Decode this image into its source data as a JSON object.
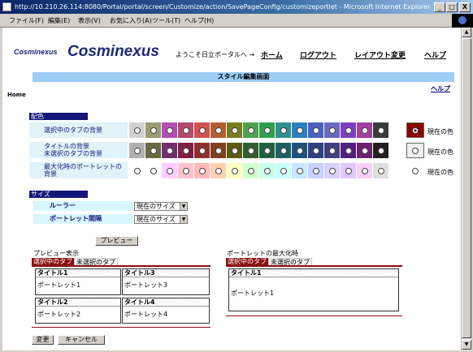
{
  "window": {
    "title": "http://10.210.26.114:8080/Portal/portal/screen/Customize/action/SavePageConfig/customizeportlet - Microsoft Internet Explorer",
    "min": "_",
    "max": "□",
    "close": "X"
  },
  "menu": [
    "ファイル(F)",
    "編集(E)",
    "表示(V)",
    "お気に入り(A)",
    "ツール(T)",
    "ヘルプ(H)"
  ],
  "header": {
    "logo_small": "Cosminexus",
    "logo_large": "Cosminexus",
    "welcome": "ようこそ日立ポータルへ →",
    "links": [
      "ホーム",
      "ログアウト",
      "レイアウト変更",
      "ヘルプ"
    ]
  },
  "page": {
    "title": "スタイル編集画面",
    "help": "ヘルプ",
    "home": "Home"
  },
  "colors_section": {
    "heading": "配色",
    "rows": [
      {
        "label": "選択中のタブの背景",
        "swatches": [
          "#d2d2d2",
          "#9a9a6e",
          "#b050b0",
          "#b24a6c",
          "#d05050",
          "#b06030",
          "#7a7a20",
          "#50a050",
          "#30a050",
          "#309090",
          "#2a80c0",
          "#4a60c0",
          "#6a6ac0",
          "#7a40c0",
          "#a040a0",
          "#3a3a3a"
        ],
        "current_color": "#8b0000",
        "current_selected": true,
        "current_label": "現在の色"
      },
      {
        "label": "タイトルの背景\n未選択のタブの背景",
        "swatches": [
          "#b0b0b0",
          "#6a6a40",
          "#703070",
          "#802040",
          "#903030",
          "#804020",
          "#5a5a10",
          "#306030",
          "#206040",
          "#206060",
          "#205080",
          "#304080",
          "#404080",
          "#502080",
          "#702070",
          "#202020"
        ],
        "current_color": "#f0f0f0",
        "current_selected": false,
        "current_label": "現在の色"
      },
      {
        "label": "最大化時のポートレットの背景",
        "swatches": [
          "#ffffff",
          "#ffffff",
          "#ffccff",
          "#ffc0d0",
          "#ffb8b8",
          "#ffd0b0",
          "#ffffc0",
          "#d0ffd0",
          "#c8ffe8",
          "#c8ffff",
          "#c8e8ff",
          "#c8d0ff",
          "#d8d0ff",
          "#e0c8ff",
          "#f8d0f8",
          "#e0e0e0"
        ],
        "current_color": "#ffffff",
        "current_selected": false,
        "current_label": "現在の色"
      }
    ]
  },
  "size_section": {
    "heading": "サイズ",
    "rows": [
      {
        "label": "ルーラー",
        "value": "現在のサイズ"
      },
      {
        "label": "ポートレット間隔",
        "value": "現在のサイズ"
      }
    ],
    "preview_button": "プレビュー"
  },
  "preview": {
    "heading": "プレビュー表示",
    "tab_selected": "選択中のタブ",
    "tab_unselected": "未選択のタブ",
    "portlets": [
      {
        "title": "タイトル1",
        "body": "ポートレット1"
      },
      {
        "title": "タイトル3",
        "body": "ポートレット3"
      },
      {
        "title": "タイトル2",
        "body": "ポートレット2"
      },
      {
        "title": "タイトル4",
        "body": "ポートレット4"
      }
    ]
  },
  "maximized": {
    "heading": "ポートレットの最大化時",
    "tab_selected": "選択中のタブ",
    "tab_unselected": "未選択のタブ",
    "portlet": {
      "title": "タイトル1",
      "body": "ポートレット1"
    }
  },
  "actions": {
    "change": "変更",
    "cancel": "キャンセル"
  }
}
